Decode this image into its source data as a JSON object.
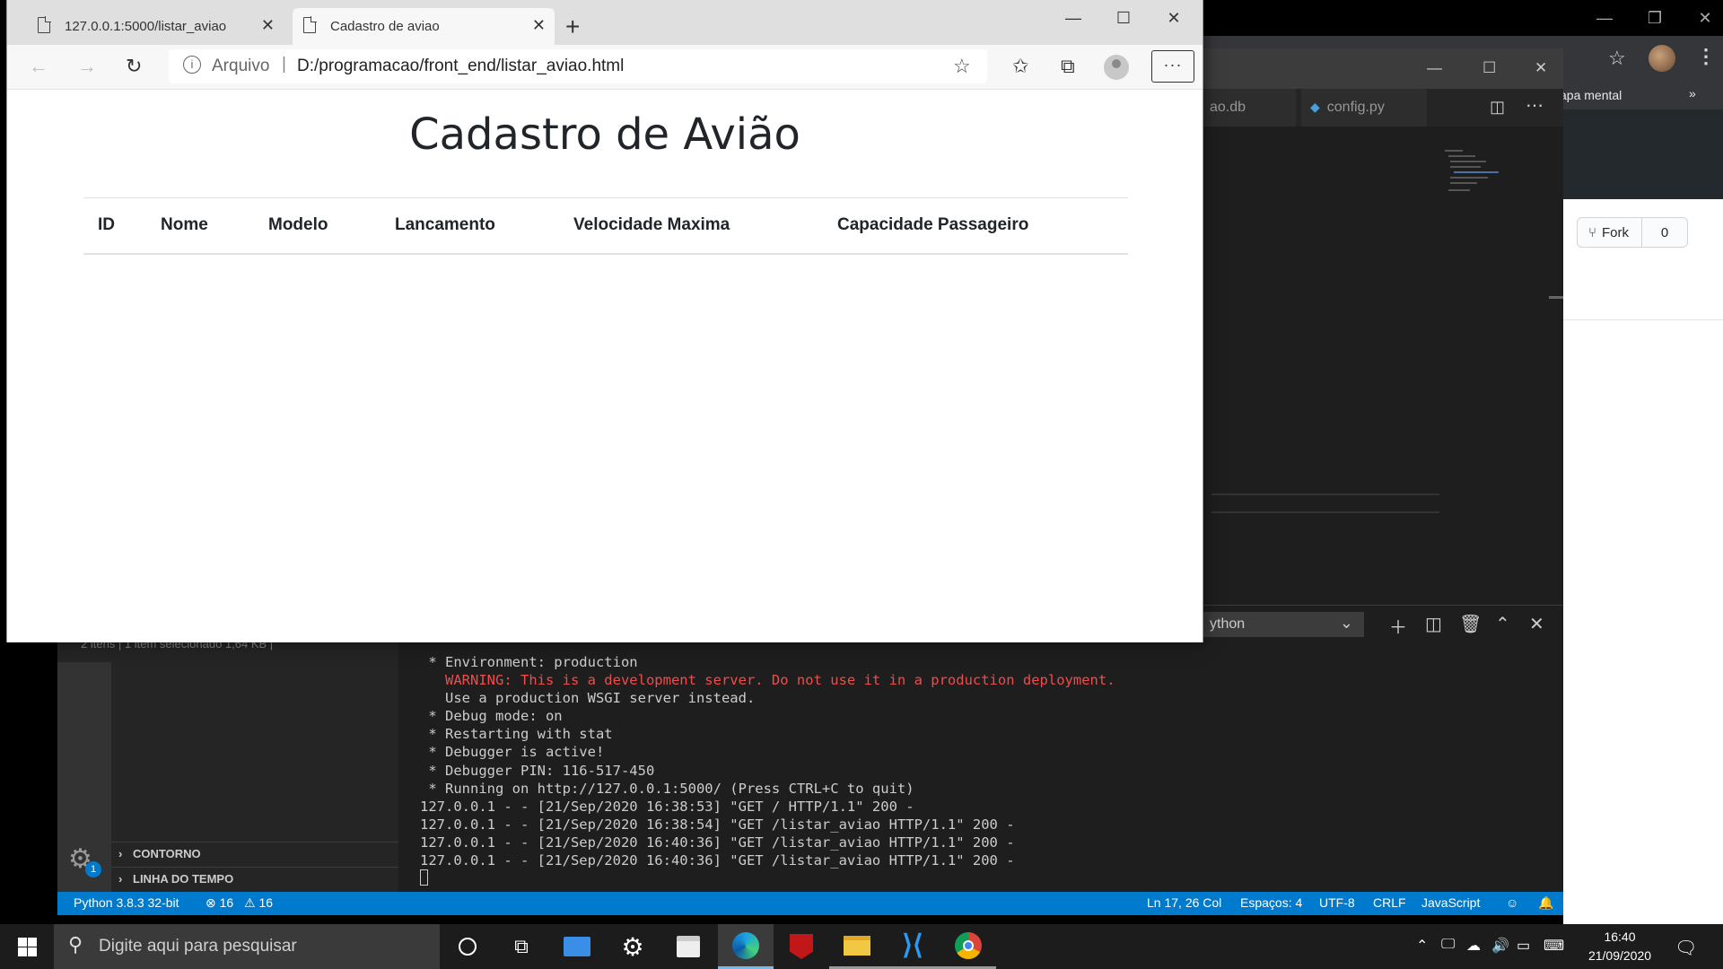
{
  "background_browser": {
    "bookmark": "apa mental",
    "more": "»",
    "fork_label": "Fork",
    "fork_count": "0"
  },
  "vscode": {
    "tabs": [
      {
        "label": "ao.db"
      },
      {
        "label": "config.py"
      }
    ],
    "sections": {
      "outline": "CONTORNO",
      "timeline": "LINHA DO TEMPO"
    },
    "gear_badge": "1",
    "explorer_status": "2 itens  |  1 item selecionado  1,64 KB  |",
    "terminal_shell": "ython",
    "terminal_lines": [
      {
        "text": " * Environment: production",
        "type": "normal"
      },
      {
        "text": "   WARNING: This is a development server. Do not use it in a production deployment.",
        "type": "warn"
      },
      {
        "text": "   Use a production WSGI server instead.",
        "type": "normal"
      },
      {
        "text": " * Debug mode: on",
        "type": "normal"
      },
      {
        "text": " * Restarting with stat",
        "type": "normal"
      },
      {
        "text": " * Debugger is active!",
        "type": "normal"
      },
      {
        "text": " * Debugger PIN: 116-517-450",
        "type": "normal"
      },
      {
        "text": " * Running on http://127.0.0.1:5000/ (Press CTRL+C to quit)",
        "type": "normal"
      },
      {
        "text": "127.0.0.1 - - [21/Sep/2020 16:38:53] \"GET / HTTP/1.1\" 200 -",
        "type": "normal"
      },
      {
        "text": "127.0.0.1 - - [21/Sep/2020 16:38:54] \"GET /listar_aviao HTTP/1.1\" 200 -",
        "type": "normal"
      },
      {
        "text": "127.0.0.1 - - [21/Sep/2020 16:40:36] \"GET /listar_aviao HTTP/1.1\" 200 -",
        "type": "normal"
      },
      {
        "text": "127.0.0.1 - - [21/Sep/2020 16:40:36] \"GET /listar_aviao HTTP/1.1\" 200 -",
        "type": "normal"
      }
    ],
    "status": {
      "python": "Python 3.8.3 32-bit",
      "errors": "⊗ 16",
      "warnings": "⚠ 16",
      "position": "Ln 17, 26 Col",
      "spaces": "Espaços: 4",
      "encoding": "UTF-8",
      "eol": "CRLF",
      "language": "JavaScript"
    }
  },
  "edge": {
    "tabs": [
      {
        "title": "127.0.0.1:5000/listar_aviao",
        "active": false
      },
      {
        "title": "Cadastro de aviao",
        "active": true
      }
    ],
    "address": {
      "scheme_label": "Arquivo",
      "separator": "|",
      "url": "D:/programacao/front_end/listar_aviao.html"
    },
    "page": {
      "title": "Cadastro de Avião",
      "columns": [
        "ID",
        "Nome",
        "Modelo",
        "Lancamento",
        "Velocidade Maxima",
        "Capacidade Passageiro"
      ]
    }
  },
  "taskbar": {
    "search_placeholder": "Digite aqui para pesquisar",
    "time": "16:40",
    "date": "21/09/2020",
    "apps": [
      {
        "name": "cortana-icon",
        "active": false
      },
      {
        "name": "task-view-icon",
        "active": false
      },
      {
        "name": "mail-icon",
        "active": false
      },
      {
        "name": "settings-icon",
        "active": false
      },
      {
        "name": "store-icon",
        "active": false
      },
      {
        "name": "edge-icon",
        "active": true
      },
      {
        "name": "mcafee-icon",
        "active": false
      },
      {
        "name": "file-explorer-icon",
        "active": false
      },
      {
        "name": "vscode-icon",
        "active": false
      },
      {
        "name": "chrome-icon",
        "active": false
      }
    ]
  }
}
